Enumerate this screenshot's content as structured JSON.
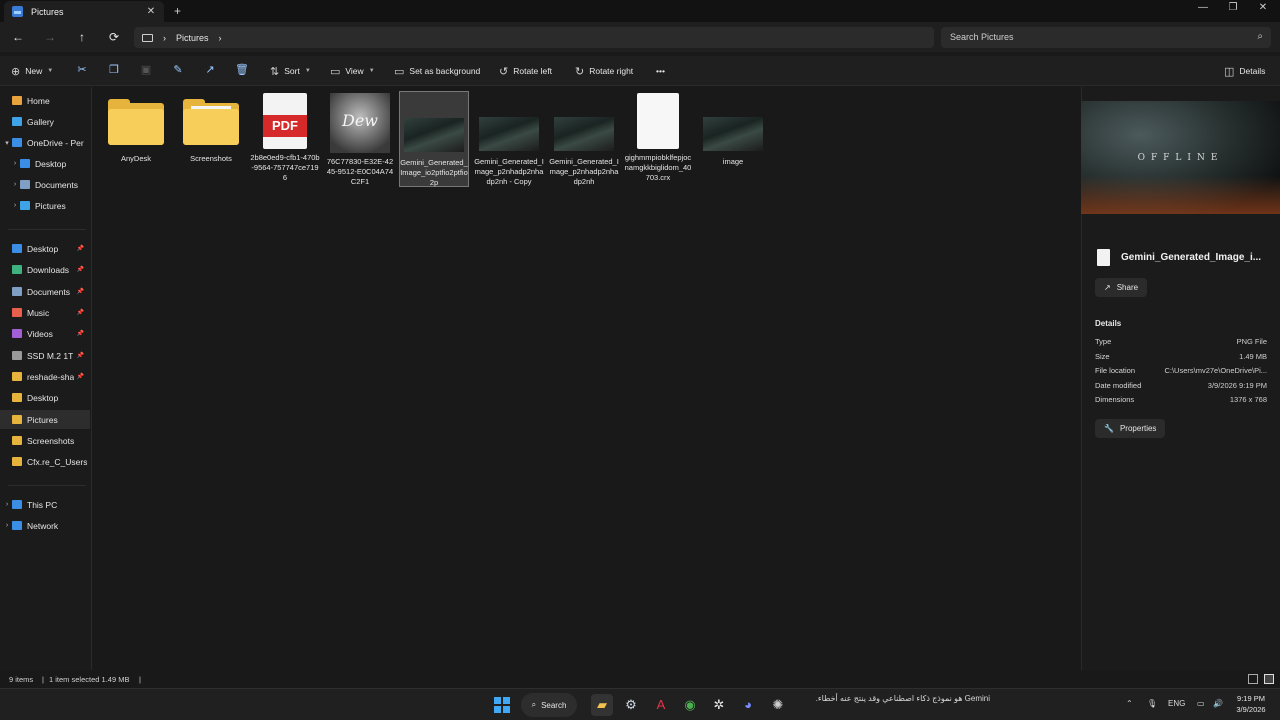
{
  "window": {
    "tab_title": "Pictures",
    "tab_close": "✕",
    "new_tab": "+",
    "controls": {
      "minimize": "—",
      "maximize": "❐",
      "close": "✕"
    }
  },
  "nav": {
    "back": "←",
    "forward": "→",
    "up": "↑",
    "refresh": "⟳",
    "breadcrumb": [
      "Pictures"
    ],
    "chevron": "›",
    "search_placeholder": "Search Pictures",
    "search_icon": "⌕"
  },
  "toolbar": {
    "new_label": "New",
    "sort_label": "Sort",
    "view_label": "View",
    "set_background_label": "Set as background",
    "rotate_left_label": "Rotate left",
    "rotate_right_label": "Rotate right",
    "more_label": "•••",
    "details_label": "Details",
    "icons": [
      "cut-icon",
      "copy-icon",
      "paste-icon",
      "rename-icon",
      "share-icon",
      "delete-icon"
    ]
  },
  "sidebar": {
    "top": [
      {
        "label": "Home",
        "color": "#e8a33c",
        "expand": ""
      },
      {
        "label": "Gallery",
        "color": "#3fa3e8",
        "expand": ""
      },
      {
        "label": "OneDrive - Per",
        "color": "#3a8ee6",
        "expand": "▾"
      },
      {
        "label": "Desktop",
        "color": "#3a8ee6",
        "expand": "›"
      },
      {
        "label": "Documents",
        "color": "#7fa0c4",
        "expand": "›"
      },
      {
        "label": "Pictures",
        "color": "#3fa3e8",
        "expand": "›"
      }
    ],
    "quick": [
      {
        "label": "Desktop",
        "color": "#3a8ee6",
        "pin": true
      },
      {
        "label": "Downloads",
        "color": "#3fb37f",
        "pin": true
      },
      {
        "label": "Documents",
        "color": "#7fa0c4",
        "pin": true
      },
      {
        "label": "Music",
        "color": "#e8604c",
        "pin": true
      },
      {
        "label": "Videos",
        "color": "#a35fd6",
        "pin": true
      },
      {
        "label": "SSD M.2 1T",
        "color": "#9a9a9a",
        "pin": true
      },
      {
        "label": "reshade-sha",
        "color": "#e6b43c",
        "pin": true
      },
      {
        "label": "Desktop",
        "color": "#e6b43c",
        "pin": false
      },
      {
        "label": "Pictures",
        "color": "#e6b43c",
        "pin": false,
        "selected": true
      },
      {
        "label": "Screenshots",
        "color": "#e6b43c",
        "pin": false
      },
      {
        "label": "Cfx.re_C_Users",
        "color": "#e6b43c",
        "pin": false
      }
    ],
    "bottom": [
      {
        "label": "This PC",
        "color": "#3a8ee6",
        "expand": "›"
      },
      {
        "label": "Network",
        "color": "#3a8ee6",
        "expand": "›"
      }
    ],
    "pin_glyph": "📌"
  },
  "files": [
    {
      "name": "AnyDesk",
      "kind": "folder"
    },
    {
      "name": "Screenshots",
      "kind": "folder-paper"
    },
    {
      "name": "2b8e0ed9-cfb1-470b-9564-757747ce7196",
      "kind": "pdf",
      "badge": "PDF"
    },
    {
      "name": "76C77830-E32E-4245-9512-E0C04A74C2F1",
      "kind": "dew",
      "badge": "Dew"
    },
    {
      "name": "Gemini_Generated_Image_io2ptfio2ptfio2p",
      "kind": "gem",
      "selected": true
    },
    {
      "name": "Gemini_Generated_Image_p2nhadp2nhadp2nh - Copy",
      "kind": "gem"
    },
    {
      "name": "Gemini_Generated_Image_p2nhadp2nhadp2nh",
      "kind": "gem"
    },
    {
      "name": "gighmmpiobklfepjocnamgkkbiglidom_40703.crx",
      "kind": "blank"
    },
    {
      "name": "image",
      "kind": "gem"
    }
  ],
  "details": {
    "preview_text": "OFFLINE",
    "file_title": "Gemini_Generated_Image_i...",
    "share_label": "Share",
    "section_label": "Details",
    "rows": [
      {
        "key": "Type",
        "value": "PNG File"
      },
      {
        "key": "Size",
        "value": "1.49 MB"
      },
      {
        "key": "File location",
        "value": "C:\\Users\\mv27e\\OneDrive\\Pi..."
      },
      {
        "key": "Date modified",
        "value": "3/9/2026 9:19 PM"
      },
      {
        "key": "Dimensions",
        "value": "1376 x 768"
      }
    ],
    "properties_label": "Properties"
  },
  "status": {
    "items": "9 items",
    "selected": "1 item selected  1.49 MB",
    "divider": "|"
  },
  "taskbar": {
    "search_label": "Search",
    "notice": "Gemini هو نموذج ذكاء اصطناعي وقد ينتج عنه أخطاء.",
    "language": "ENG",
    "time": "9:19 PM",
    "date": "3/9/2026"
  }
}
